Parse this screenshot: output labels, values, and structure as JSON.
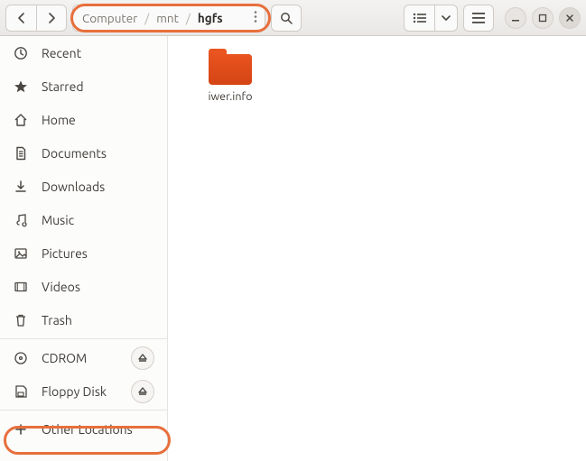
{
  "path": {
    "segs": [
      "Computer",
      "mnt",
      "hgfs"
    ],
    "sep": "/"
  },
  "sidebar": {
    "items": [
      {
        "label": "Recent"
      },
      {
        "label": "Starred"
      },
      {
        "label": "Home"
      },
      {
        "label": "Documents"
      },
      {
        "label": "Downloads"
      },
      {
        "label": "Music"
      },
      {
        "label": "Pictures"
      },
      {
        "label": "Videos"
      },
      {
        "label": "Trash"
      }
    ],
    "drives": [
      {
        "label": "CDROM"
      },
      {
        "label": "Floppy Disk"
      }
    ],
    "other": "Other Locations"
  },
  "files": [
    {
      "name": "iwer.info"
    }
  ]
}
